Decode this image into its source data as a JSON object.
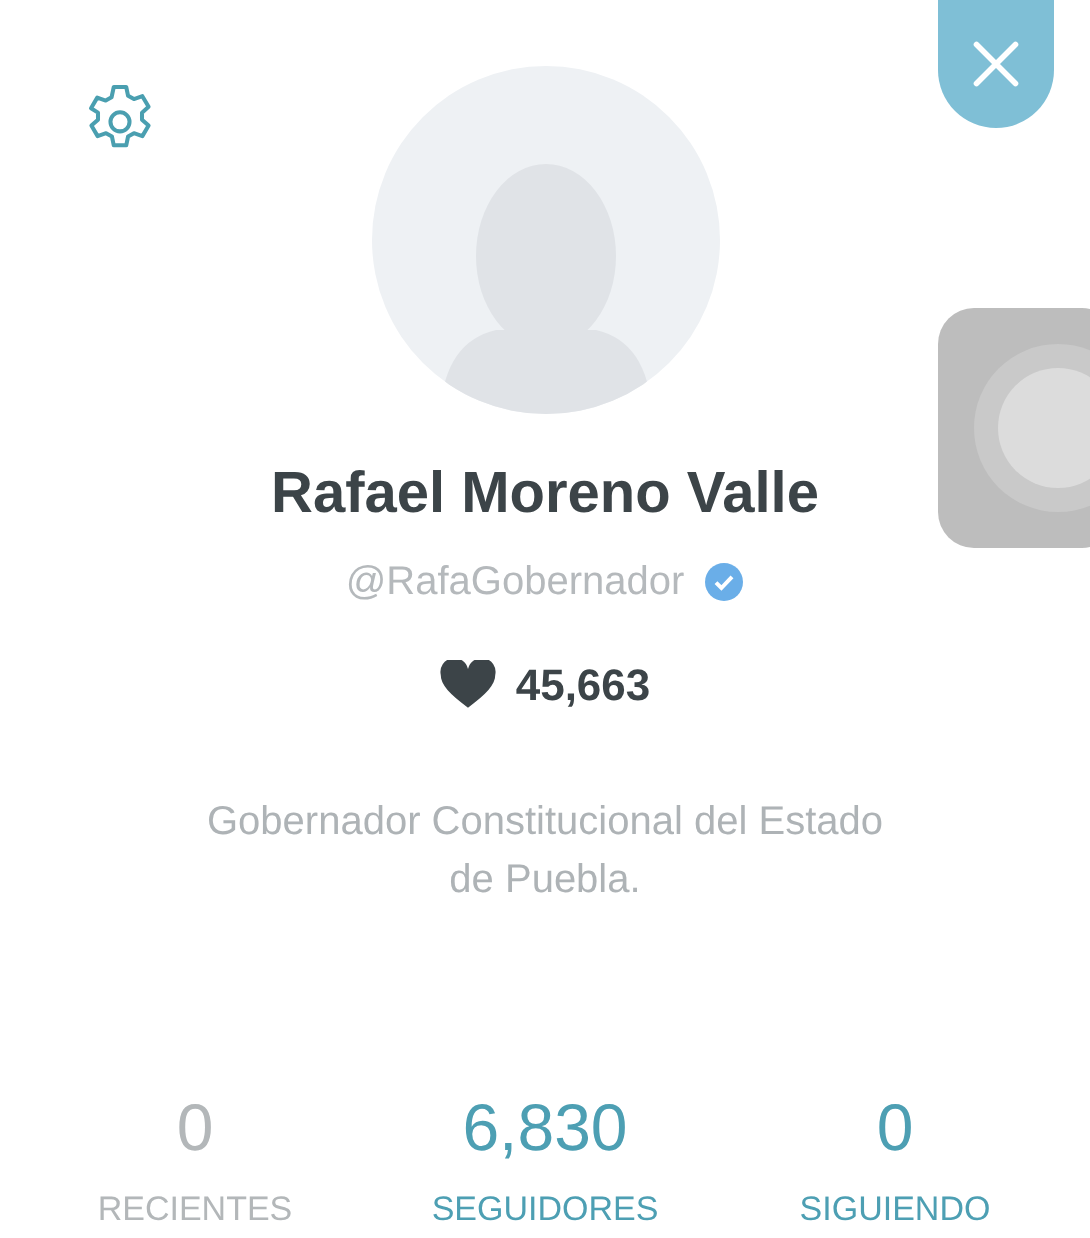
{
  "profile": {
    "name": "Rafael Moreno Valle",
    "handle": "@RafaGobernador",
    "verified": true,
    "likes": "45,663",
    "bio": "Gobernador Constitucional del Estado de Puebla."
  },
  "stats": [
    {
      "value": "0",
      "label": "RECIENTES",
      "disabled": true
    },
    {
      "value": "6,830",
      "label": "SEGUIDORES",
      "disabled": false
    },
    {
      "value": "0",
      "label": "SIGUIENDO",
      "disabled": false
    }
  ]
}
